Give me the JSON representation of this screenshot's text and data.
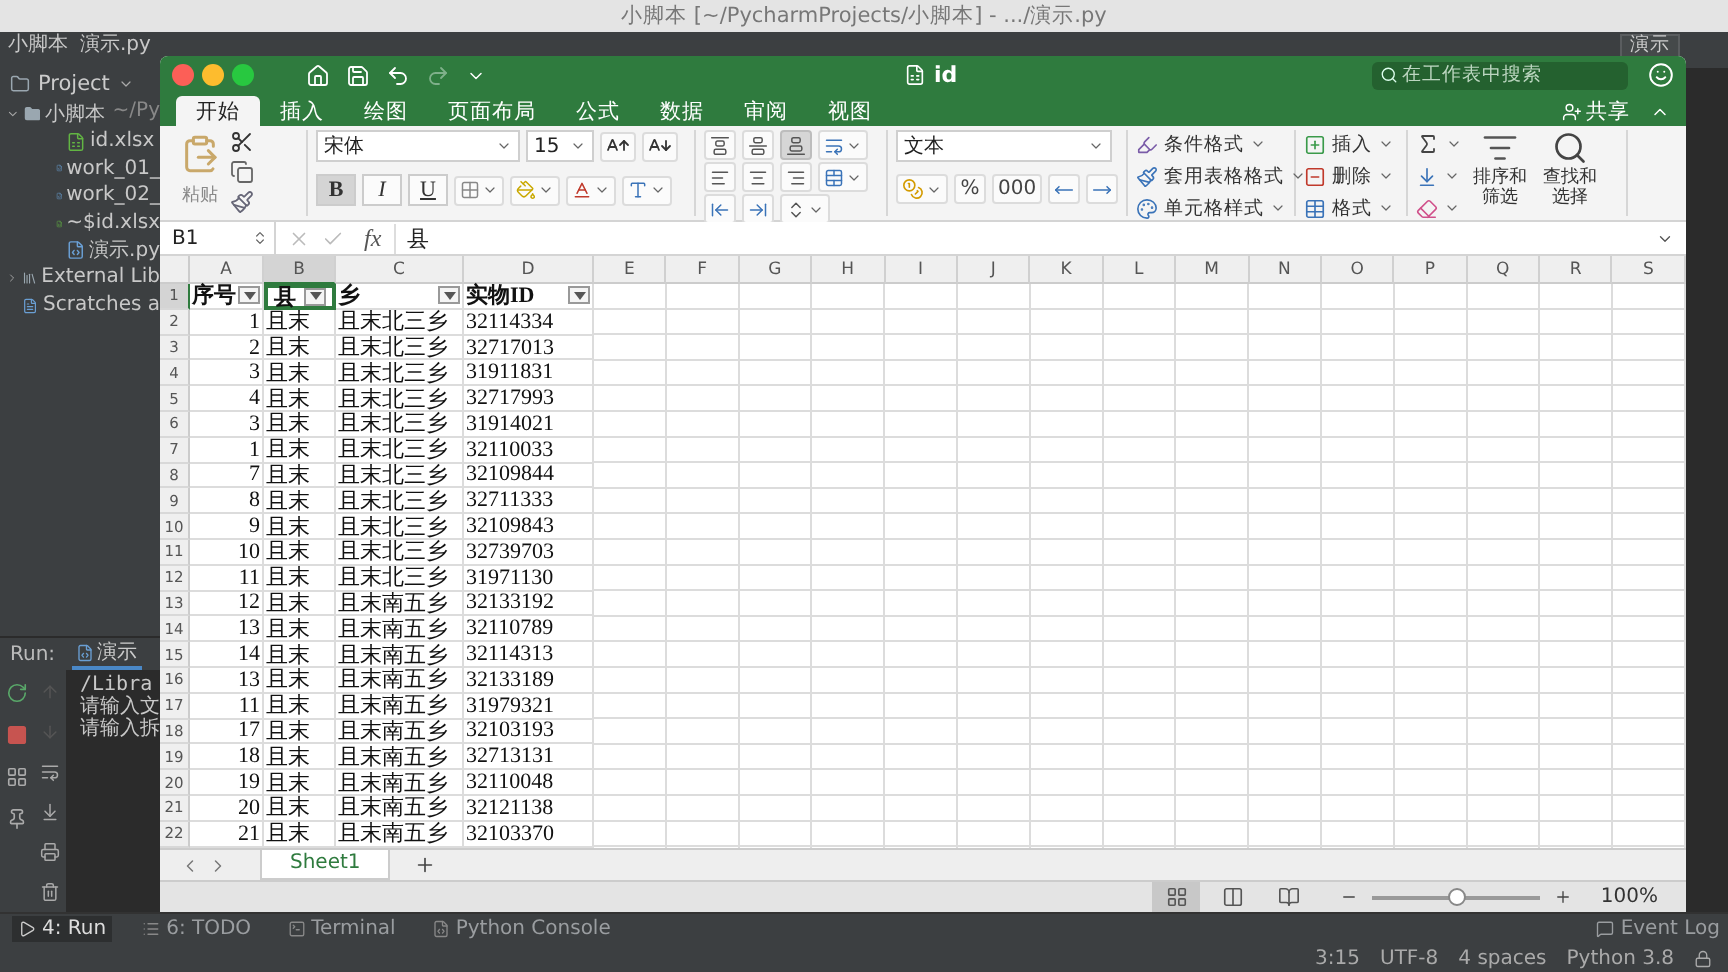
{
  "mac_window": {
    "title": "小脚本 [~/PycharmProjects/小脚本] - .../演示.py"
  },
  "ide": {
    "breadcrumbs": [
      "小脚本",
      "演示.py"
    ],
    "run_config": "演示",
    "project_panel": {
      "title": "Project",
      "tree": [
        {
          "label": "小脚本",
          "suffix": "~/Py",
          "kind": "folder",
          "expanded": true,
          "children": [
            {
              "label": "id.xlsx",
              "kind": "excel"
            },
            {
              "label": "work_01_",
              "kind": "python"
            },
            {
              "label": "work_02_",
              "kind": "python"
            },
            {
              "label": "~$id.xlsx",
              "kind": "excel"
            },
            {
              "label": "演示.py",
              "kind": "python"
            }
          ]
        },
        {
          "label": "External Lib",
          "kind": "library",
          "expanded": false
        },
        {
          "label": "Scratches a",
          "kind": "scratch"
        }
      ]
    },
    "run_panel": {
      "title": "Run:",
      "tab": "演示",
      "console": [
        "/Libra",
        "请输入文",
        "请输入拆"
      ]
    },
    "tool_windows": [
      {
        "label": "4: Run",
        "kind": "run",
        "selected": true
      },
      {
        "label": "6: TODO",
        "kind": "todo",
        "selected": false
      },
      {
        "label": "Terminal",
        "kind": "terminal",
        "selected": false
      },
      {
        "label": "Python Console",
        "kind": "console",
        "selected": false
      }
    ],
    "event_log": "Event Log",
    "status": [
      "3:15",
      "UTF-8",
      "4 spaces",
      "Python 3.8"
    ]
  },
  "excel": {
    "title": "id",
    "search": {
      "placeholder": "在工作表中搜索"
    },
    "share": "共享",
    "tabs": [
      {
        "label": "开始",
        "selected": true
      },
      {
        "label": "插入",
        "selected": false
      },
      {
        "label": "绘图",
        "selected": false
      },
      {
        "label": "页面布局",
        "selected": false
      },
      {
        "label": "公式",
        "selected": false
      },
      {
        "label": "数据",
        "selected": false
      },
      {
        "label": "审阅",
        "selected": false
      },
      {
        "label": "视图",
        "selected": false
      }
    ],
    "ribbon": {
      "paste": "粘贴",
      "font_name": "宋体",
      "font_size": "15",
      "font_styles": [
        {
          "kind": "bold",
          "label": "B",
          "selected": true
        },
        {
          "kind": "italic",
          "label": "I",
          "selected": false
        },
        {
          "kind": "underline",
          "label": "U",
          "selected": false
        }
      ],
      "vertical_align": [
        {
          "kind": "top",
          "selected": false
        },
        {
          "kind": "middle",
          "selected": false
        },
        {
          "kind": "bottom",
          "selected": true
        }
      ],
      "horizontal_align": [
        {
          "kind": "left",
          "selected": false
        },
        {
          "kind": "center",
          "selected": false
        },
        {
          "kind": "right",
          "selected": false
        }
      ],
      "number_format": "文本",
      "number_buttons": [
        "%",
        "000"
      ],
      "styles": [
        {
          "label": "条件格式",
          "kind": "conditional"
        },
        {
          "label": "套用表格格式",
          "kind": "table"
        },
        {
          "label": "单元格样式",
          "kind": "cell"
        }
      ],
      "cells": [
        {
          "label": "插入",
          "kind": "insert"
        },
        {
          "label": "删除",
          "kind": "delete"
        },
        {
          "label": "格式",
          "kind": "format"
        }
      ],
      "sort_filter": "排序和筛选",
      "find_select": "查找和选择"
    },
    "formula_bar": {
      "name_box": "B1",
      "fx": "fx",
      "value": "县"
    },
    "columns": [
      "A",
      "B",
      "C",
      "D",
      "E",
      "F",
      "G",
      "H",
      "I",
      "J",
      "K",
      "L",
      "M",
      "N",
      "O",
      "P",
      "Q",
      "R",
      "S"
    ],
    "rows": [
      {
        "kind": "header",
        "number": "1",
        "cells": [
          {
            "text": "序号",
            "filter": true,
            "selected": false
          },
          {
            "text": "县",
            "filter": true,
            "selected": true
          },
          {
            "text": "乡",
            "filter": true,
            "selected": false
          },
          {
            "text": "实物ID",
            "filter": true,
            "selected": false
          }
        ]
      },
      {
        "kind": "data",
        "number": "2",
        "cells": [
          "1",
          "且末",
          "且末北三乡",
          "32114334"
        ]
      },
      {
        "kind": "data",
        "number": "3",
        "cells": [
          "2",
          "且末",
          "且末北三乡",
          "32717013"
        ]
      },
      {
        "kind": "data",
        "number": "4",
        "cells": [
          "3",
          "且末",
          "且末北三乡",
          "31911831"
        ]
      },
      {
        "kind": "data",
        "number": "5",
        "cells": [
          "4",
          "且末",
          "且末北三乡",
          "32717993"
        ]
      },
      {
        "kind": "data",
        "number": "6",
        "cells": [
          "3",
          "且末",
          "且末北三乡",
          "31914021"
        ]
      },
      {
        "kind": "data",
        "number": "7",
        "cells": [
          "1",
          "且末",
          "且末北三乡",
          "32110033"
        ]
      },
      {
        "kind": "data",
        "number": "8",
        "cells": [
          "7",
          "且末",
          "且末北三乡",
          "32109844"
        ]
      },
      {
        "kind": "data",
        "number": "9",
        "cells": [
          "8",
          "且末",
          "且末北三乡",
          "32711333"
        ]
      },
      {
        "kind": "data",
        "number": "10",
        "cells": [
          "9",
          "且末",
          "且末北三乡",
          "32109843"
        ]
      },
      {
        "kind": "data",
        "number": "11",
        "cells": [
          "10",
          "且末",
          "且末北三乡",
          "32739703"
        ]
      },
      {
        "kind": "data",
        "number": "12",
        "cells": [
          "11",
          "且末",
          "且末北三乡",
          "31971130"
        ]
      },
      {
        "kind": "data",
        "number": "13",
        "cells": [
          "12",
          "且末",
          "且末南五乡",
          "32133192"
        ]
      },
      {
        "kind": "data",
        "number": "14",
        "cells": [
          "13",
          "且末",
          "且末南五乡",
          "32110789"
        ]
      },
      {
        "kind": "data",
        "number": "15",
        "cells": [
          "14",
          "且末",
          "且末南五乡",
          "32114313"
        ]
      },
      {
        "kind": "data",
        "number": "16",
        "cells": [
          "13",
          "且末",
          "且末南五乡",
          "32133189"
        ]
      },
      {
        "kind": "data",
        "number": "17",
        "cells": [
          "11",
          "且末",
          "且末南五乡",
          "31979321"
        ]
      },
      {
        "kind": "data",
        "number": "18",
        "cells": [
          "17",
          "且末",
          "且末南五乡",
          "32103193"
        ]
      },
      {
        "kind": "data",
        "number": "19",
        "cells": [
          "18",
          "且末",
          "且末南五乡",
          "32713131"
        ]
      },
      {
        "kind": "data",
        "number": "20",
        "cells": [
          "19",
          "且末",
          "且末南五乡",
          "32110048"
        ]
      },
      {
        "kind": "data",
        "number": "21",
        "cells": [
          "20",
          "且末",
          "且末南五乡",
          "32121138"
        ]
      },
      {
        "kind": "data",
        "number": "22",
        "cells": [
          "21",
          "且末",
          "且末南五乡",
          "32103370"
        ]
      }
    ],
    "sheets": [
      {
        "label": "Sheet1",
        "selected": true
      }
    ],
    "views": [
      {
        "kind": "normal",
        "selected": true
      },
      {
        "kind": "page_layout",
        "selected": false
      },
      {
        "kind": "page_break",
        "selected": false
      }
    ],
    "zoom": {
      "level": 0.5,
      "reading": "100%"
    }
  }
}
